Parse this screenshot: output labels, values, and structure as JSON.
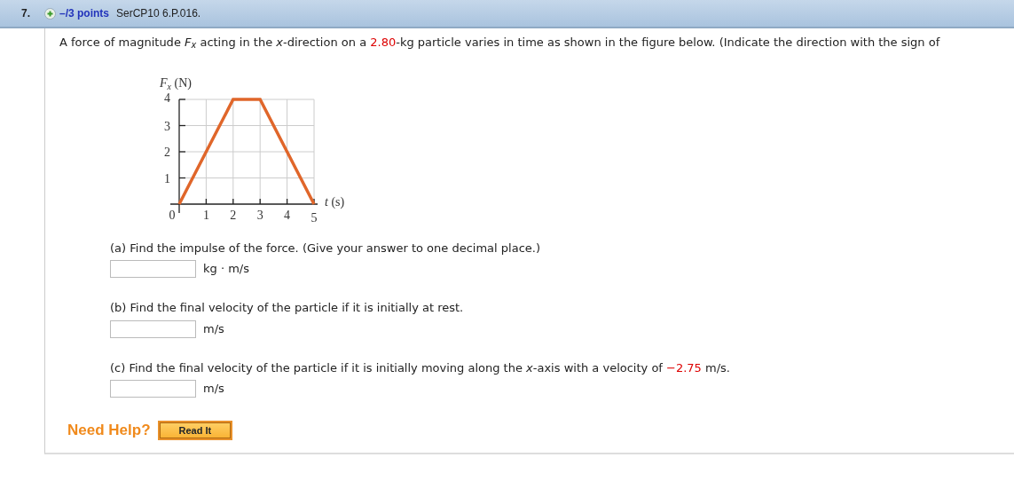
{
  "question": {
    "number": "7.",
    "points": "–/3 points",
    "source": "SerCP10 6.P.016."
  },
  "prompt": [
    {
      "kind": "plain",
      "text": "A force of magnitude "
    },
    {
      "kind": "math",
      "text": "F$_{x}$"
    },
    {
      "kind": "plain",
      "text": " acting in the "
    },
    {
      "kind": "math",
      "text": "x"
    },
    {
      "kind": "plain",
      "text": "-direction on a "
    },
    {
      "kind": "given",
      "text": "2.80"
    },
    {
      "kind": "plain",
      "text": "-kg particle varies in time as shown in the figure below. (Indicate the direction with the sign of"
    }
  ],
  "figure": {
    "chart_data": {
      "type": "line",
      "xlabel": "t (s)",
      "ylabel": "F$_{x}$ (N)",
      "x": [
        0,
        1,
        2,
        3,
        4,
        5
      ],
      "grid": true,
      "series": [
        {
          "color": "#e0662a",
          "values": [
            0,
            2,
            4,
            4,
            2,
            0
          ]
        }
      ],
      "xlim": [
        0,
        5
      ],
      "ylim": [
        0,
        4
      ],
      "xticks": [
        0,
        1,
        2,
        3,
        4,
        5
      ],
      "yticks": [
        1,
        2,
        3,
        4
      ]
    }
  },
  "parts": [
    {
      "prompt": [
        {
          "kind": "plain",
          "text": "(a) Find the impulse of the force. (Give your answer to one decimal place.)"
        }
      ],
      "unit": "kg · m/s"
    },
    {
      "prompt": [
        {
          "kind": "plain",
          "text": "(b) Find the final velocity of the particle if it is initially at rest."
        }
      ],
      "unit": "m/s"
    },
    {
      "prompt": [
        {
          "kind": "plain",
          "text": "(c) Find the final velocity of the particle if it is initially moving along the "
        },
        {
          "kind": "math",
          "text": "x"
        },
        {
          "kind": "plain",
          "text": "-axis with a velocity of "
        },
        {
          "kind": "given",
          "text": "−2.75"
        },
        {
          "kind": "plain",
          "text": " m/s."
        }
      ],
      "unit": "m/s"
    }
  ],
  "help": {
    "label": "Need Help?",
    "buttons": [
      "Read It"
    ]
  }
}
